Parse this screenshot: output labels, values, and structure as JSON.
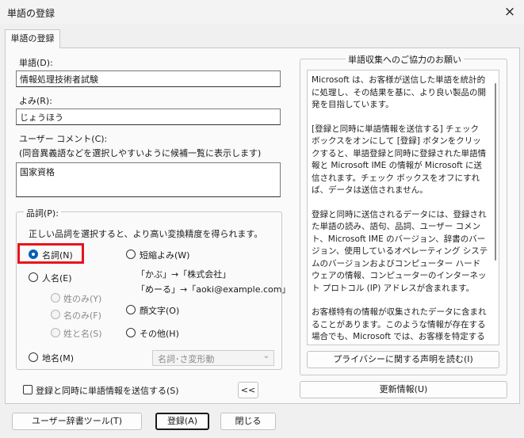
{
  "window": {
    "title": "単語の登録",
    "close_icon": "×"
  },
  "tab": {
    "label": "単語の登録"
  },
  "fields": {
    "word_label": "単語(D):",
    "word_value": "情報処理技術者試験",
    "reading_label": "よみ(R):",
    "reading_value": "じょうほう",
    "comment_label": "ユーザー コメント(C):",
    "comment_hint": "(同音異義語などを選択しやすいように候補一覧に表示します)",
    "comment_value": "国家資格"
  },
  "pos": {
    "group_label": "品詞(P):",
    "description": "正しい品詞を選択すると、より高い変換精度を得られます。",
    "options": {
      "noun": "名詞(N)",
      "person": "人名(E)",
      "surname": "姓のみ(Y)",
      "given_name": "名のみ(F)",
      "full_name": "姓と名(S)",
      "place": "地名(M)",
      "abbrev": "短縮よみ(W)",
      "abbrev_example1": "「かぶ」→「株式会社」",
      "abbrev_example2": "「めーる」→「aoki@example.com」",
      "emoticon": "顔文字(O)",
      "other": "その他(H)"
    },
    "selected": "noun",
    "subtype_select": "名詞･さ変形動"
  },
  "send_checkbox": {
    "label": "登録と同時に単語情報を送信する(S)",
    "checked": false
  },
  "collapse_button": "<<",
  "info_panel": {
    "title": "単語収集へのご協力のお願い",
    "paragraphs": [
      "Microsoft は、お客様が送信した単語を統計的に処理し、その結果を基に、より良い製品の開発を目指しています。",
      "[登録と同時に単語情報を送信する] チェック ボックスをオンにして [登録] ボタンをクリックすると、単語登録と同時に登録された単語情報と Microsoft IME の情報が Microsoft に送信されます。チェック ボックスをオフにすれば、データは送信されません。",
      "登録と同時に送信されるデータには、登録された単語の読み、語句、品詞、ユーザー コメント、Microsoft IME のバージョン、辞書のバージョン、使用しているオペレーティング システムのバージョンおよびコンピューター ハードウェアの情報、コンピューターのインターネット プロトコル (IP) アドレスが含まれます。",
      "お客様特有の情報が収集されたデータに含まれることがあります。このような情報が存在する場合でも、Microsoft では、お客様を特定するために使用することはありません。"
    ],
    "privacy_button": "プライバシーに関する声明を読む(I)",
    "update_button": "更新情報(U)"
  },
  "bottom_buttons": {
    "dictionary_tool": "ユーザー辞書ツール(T)",
    "register": "登録(A)",
    "close": "閉じる"
  }
}
